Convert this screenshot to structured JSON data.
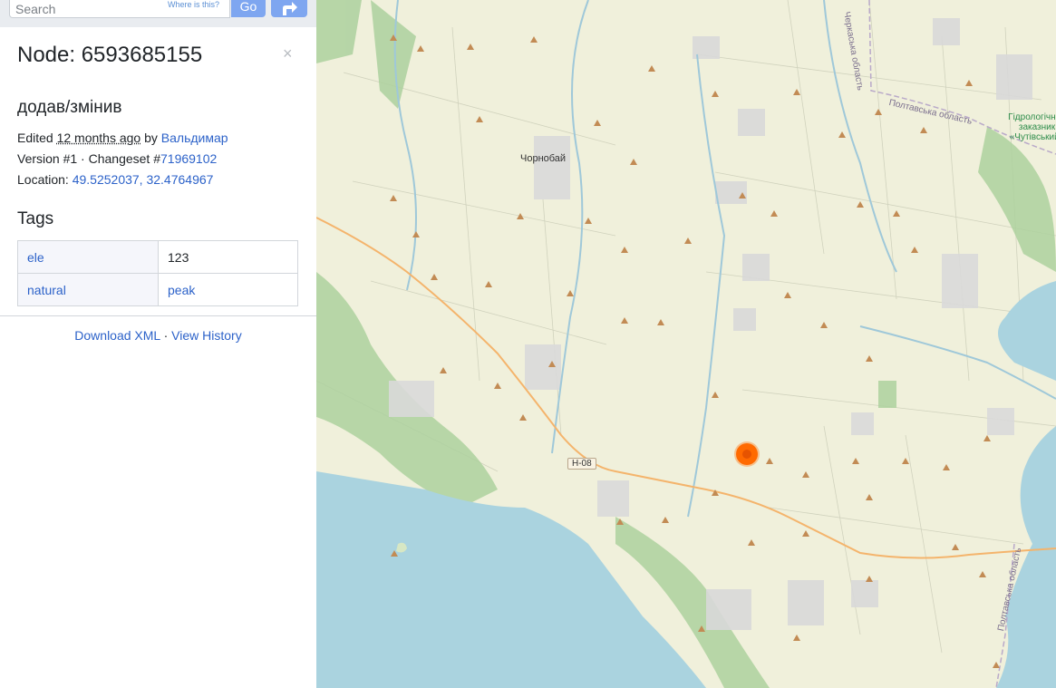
{
  "search": {
    "placeholder": "Search",
    "where_is_this": "Where is this?",
    "go_label": "Go"
  },
  "node": {
    "title": "Node: 6593685155",
    "comment": "додав/змінив",
    "edited_prefix": "Edited",
    "edited_time": "12 months ago",
    "edited_by_word": "by",
    "editor": "Вальдимар",
    "version_text": "Version #1 · Changeset #",
    "changeset": "71969102",
    "location_prefix": "Location:",
    "location_coords": "49.5252037, 32.4764967",
    "close_symbol": "×"
  },
  "tags": {
    "heading": "Tags",
    "rows": [
      {
        "key": "ele",
        "value": "123"
      },
      {
        "key": "natural",
        "value": "peak"
      }
    ]
  },
  "footer": {
    "download_xml": "Download XML",
    "separator": "·",
    "view_history": "View History"
  },
  "map": {
    "labels": {
      "chornobai": "Чорнобай",
      "road_h08": "H-08",
      "poltava_region": "Полтавська область",
      "cherkasy_region": "Черкаська область",
      "poltava_region_2": "Полтавська область",
      "reserve": "Гідрологічний заказник «Чутівський»"
    },
    "colors": {
      "land": "#f2efe3",
      "water": "#aad3df",
      "forest": "#add19e",
      "road": "#f4b46c",
      "peak": "#c28b54",
      "marker": "#ff6a00"
    }
  }
}
